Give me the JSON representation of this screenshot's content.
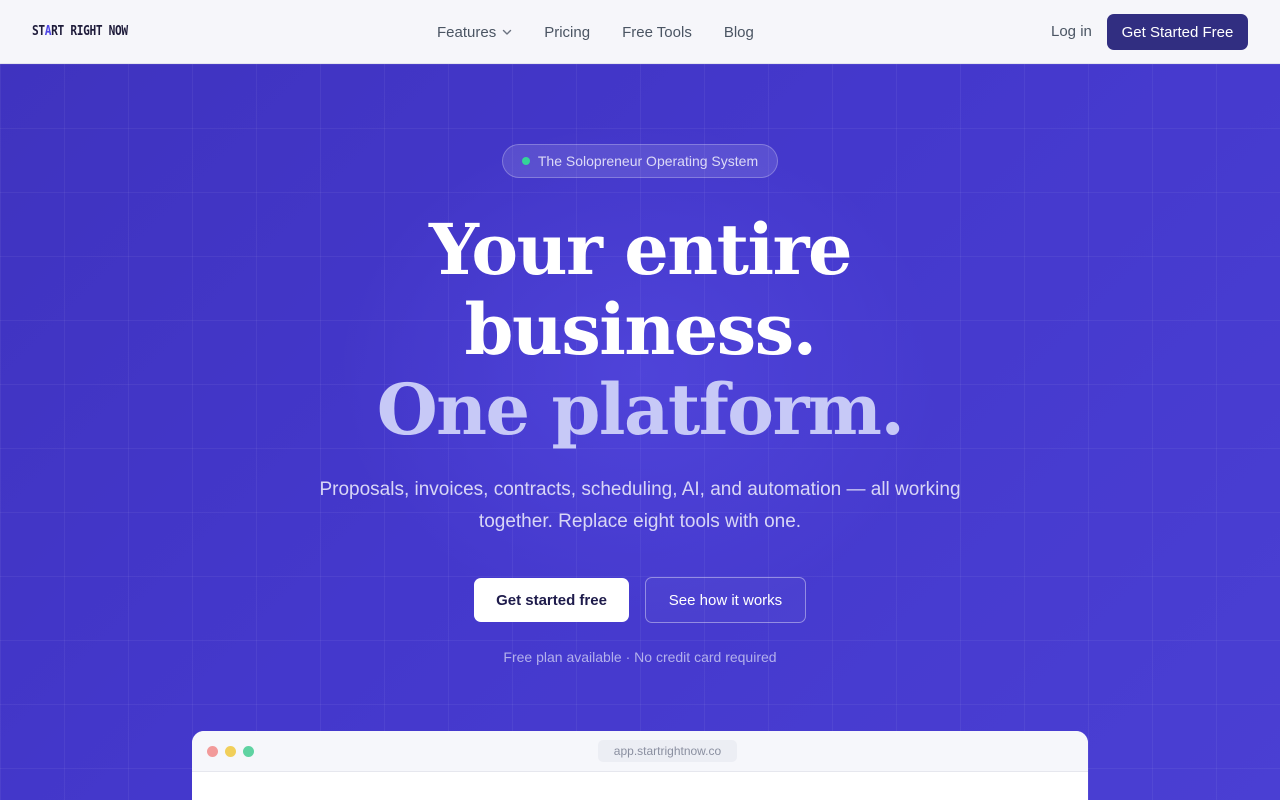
{
  "nav": {
    "logo": {
      "pre": "ST",
      "accent": "A",
      "post": "RT RIGHT NOW"
    },
    "links": [
      {
        "label": "Features",
        "has_dropdown": true
      },
      {
        "label": "Pricing"
      },
      {
        "label": "Free Tools"
      },
      {
        "label": "Blog"
      }
    ],
    "login_label": "Log in",
    "cta_label": "Get Started Free"
  },
  "hero": {
    "badge": "The Solopreneur Operating System",
    "headline": [
      "Your entire",
      "business.",
      "One platform."
    ],
    "subheadline": "Proposals, invoices, contracts, scheduling, AI, and automation — all working together. Replace eight tools with one.",
    "primary_cta": "Get started free",
    "secondary_cta": "See how it works",
    "note": "Free plan available · No credit card required"
  },
  "preview": {
    "url": "app.startrightnow.co"
  },
  "colors": {
    "brand": "#312e81",
    "hero_bg": "#4338ca",
    "accent_light": "#c7c9f7",
    "badge_dot": "#34d399"
  }
}
